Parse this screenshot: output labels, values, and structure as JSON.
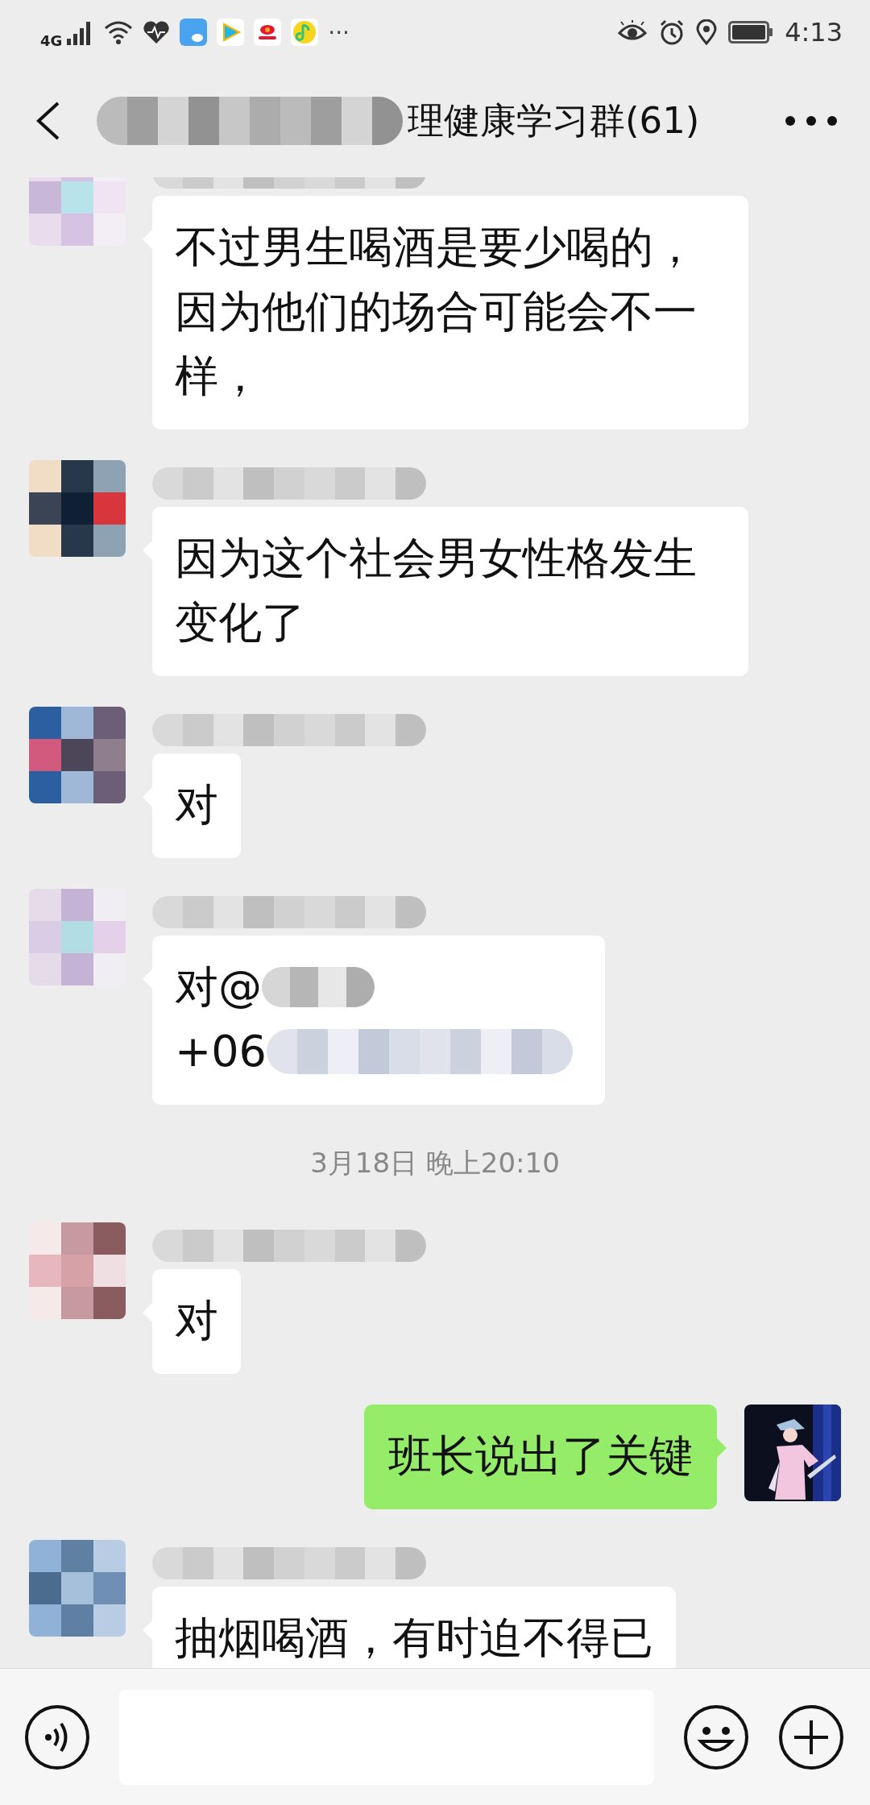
{
  "status_bar": {
    "network": "4G",
    "more": "···",
    "time": "4:13"
  },
  "header": {
    "title": "理健康学习群(61)",
    "title_blurred": true
  },
  "messages": [
    {
      "kind": "incoming",
      "name_blurred": true,
      "text": "不过男生喝酒是要少喝的，因为他们的场合可能会不一样，"
    },
    {
      "kind": "incoming",
      "name_blurred": true,
      "text": "因为这个社会男女性格发生变化了"
    },
    {
      "kind": "incoming",
      "name_blurred": true,
      "text": "对"
    },
    {
      "kind": "incoming_redacted",
      "name_blurred": true,
      "lines": [
        "对@",
        "+06"
      ]
    },
    {
      "kind": "timestamp",
      "text": "3月18日 晚上20:10"
    },
    {
      "kind": "incoming",
      "name_blurred": true,
      "text": "对"
    },
    {
      "kind": "outgoing",
      "text": "班长说出了关键"
    },
    {
      "kind": "incoming",
      "name_blurred": true,
      "text": "抽烟喝酒，有时迫不得已"
    }
  ]
}
